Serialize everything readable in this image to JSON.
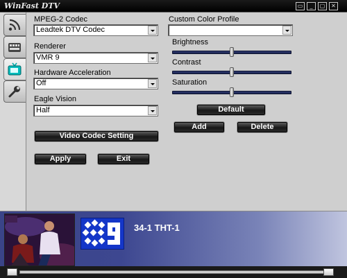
{
  "window": {
    "title": "WinFast DTV"
  },
  "tabs": [
    {
      "icon": "broadcast-icon"
    },
    {
      "icon": "keyboard-icon"
    },
    {
      "icon": "tv-icon",
      "active": true
    },
    {
      "icon": "wrench-icon"
    }
  ],
  "settings": {
    "mpeg2_codec": {
      "label": "MPEG-2 Codec",
      "value": "Leadtek DTV Codec"
    },
    "renderer": {
      "label": "Renderer",
      "value": "VMR 9"
    },
    "hardware_acceleration": {
      "label": "Hardware Acceleration",
      "value": "Off"
    },
    "eagle_vision": {
      "label": "Eagle Vision",
      "value": "Half"
    },
    "video_codec_setting_label": "Video Codec Setting",
    "apply_label": "Apply",
    "exit_label": "Exit"
  },
  "color": {
    "profile_label": "Custom Color Profile",
    "profile_value": "",
    "brightness": {
      "label": "Brightness",
      "value": 0.5
    },
    "contrast": {
      "label": "Contrast",
      "value": 0.5
    },
    "saturation": {
      "label": "Saturation",
      "value": 0.5
    },
    "default_label": "Default",
    "add_label": "Add",
    "delete_label": "Delete"
  },
  "channel": {
    "text": "34-1 THT-1"
  },
  "colors": {
    "banner": "#3a4488",
    "logo": "#1436c8",
    "slider_track": "#2e3a70"
  }
}
